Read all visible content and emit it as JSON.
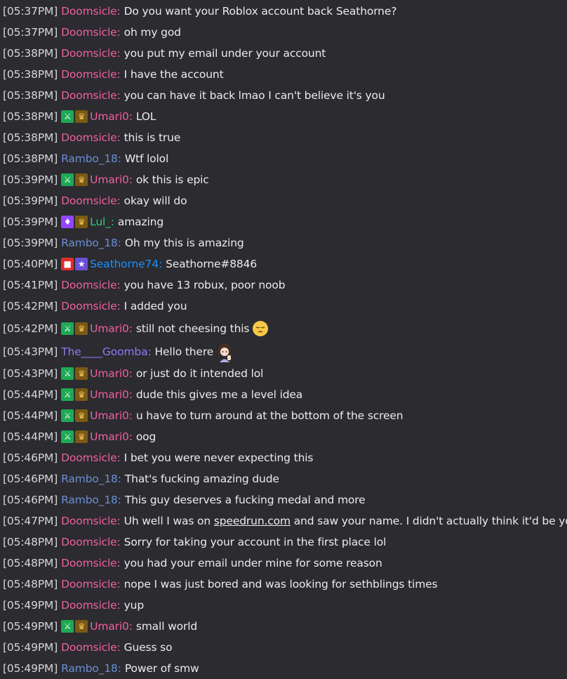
{
  "colors": {
    "background": "#2b2b30",
    "Doomsicle": "#f0609e",
    "Umari0": "#f0609e",
    "Rambo_18": "#6b8fd3",
    "Lul_": "#2ed17a",
    "Seathorne74": "#1e90ff",
    "The____Goomba": "#8a7cf5"
  },
  "messages": [
    {
      "ts": "[05:37PM]",
      "user": "Doomsicle",
      "badges": [],
      "text": "Do you want your Roblox account back Seathorne?"
    },
    {
      "ts": "[05:37PM]",
      "user": "Doomsicle",
      "badges": [],
      "text": "oh my god"
    },
    {
      "ts": "[05:38PM]",
      "user": "Doomsicle",
      "badges": [],
      "text": "you put my email under your account"
    },
    {
      "ts": "[05:38PM]",
      "user": "Doomsicle",
      "badges": [],
      "text": "I have the account"
    },
    {
      "ts": "[05:38PM]",
      "user": "Doomsicle",
      "badges": [],
      "text": "you can have it back lmao I can't believe it's you"
    },
    {
      "ts": "[05:38PM]",
      "user": "Umari0",
      "badges": [
        "moderator-sword-icon",
        "crown-icon"
      ],
      "text": "LOL"
    },
    {
      "ts": "[05:38PM]",
      "user": "Doomsicle",
      "badges": [],
      "text": "this is true"
    },
    {
      "ts": "[05:38PM]",
      "user": "Rambo_18",
      "badges": [],
      "text": "Wtf lolol"
    },
    {
      "ts": "[05:39PM]",
      "user": "Umari0",
      "badges": [
        "moderator-sword-icon",
        "crown-icon"
      ],
      "text": "ok this is epic"
    },
    {
      "ts": "[05:39PM]",
      "user": "Doomsicle",
      "badges": [],
      "text": "okay will do"
    },
    {
      "ts": "[05:39PM]",
      "user": "Lul_",
      "badges": [
        "gem-icon",
        "crown-icon"
      ],
      "text": "amazing"
    },
    {
      "ts": "[05:39PM]",
      "user": "Rambo_18",
      "badges": [],
      "text": "Oh my this is amazing"
    },
    {
      "ts": "[05:40PM]",
      "user": "Seathorne74",
      "badges": [
        "broadcaster-camera-icon",
        "star-icon"
      ],
      "text": "Seathorne#8846"
    },
    {
      "ts": "[05:41PM]",
      "user": "Doomsicle",
      "badges": [],
      "text": "you have 13 robux, poor noob"
    },
    {
      "ts": "[05:42PM]",
      "user": "Doomsicle",
      "badges": [],
      "text": "I added you"
    },
    {
      "ts": "[05:42PM]",
      "user": "Umari0",
      "badges": [
        "moderator-sword-icon",
        "crown-icon"
      ],
      "text": "still not cheesing this",
      "emote": "pensive-emoji-icon"
    },
    {
      "ts": "[05:43PM]",
      "user": "The____Goomba",
      "badges": [],
      "text": "Hello there",
      "emote": "anime-wave-emote-icon"
    },
    {
      "ts": "[05:43PM]",
      "user": "Umari0",
      "badges": [
        "moderator-sword-icon",
        "crown-icon"
      ],
      "text": "or just do it intended lol"
    },
    {
      "ts": "[05:44PM]",
      "user": "Umari0",
      "badges": [
        "moderator-sword-icon",
        "crown-icon"
      ],
      "text": "dude this gives me a level idea"
    },
    {
      "ts": "[05:44PM]",
      "user": "Umari0",
      "badges": [
        "moderator-sword-icon",
        "crown-icon"
      ],
      "text": "u have to turn around at the bottom of the screen"
    },
    {
      "ts": "[05:44PM]",
      "user": "Umari0",
      "badges": [
        "moderator-sword-icon",
        "crown-icon"
      ],
      "text": "oog"
    },
    {
      "ts": "[05:46PM]",
      "user": "Doomsicle",
      "badges": [],
      "text": "I bet you were never expecting this"
    },
    {
      "ts": "[05:46PM]",
      "user": "Rambo_18",
      "badges": [],
      "text": "That's fucking amazing dude"
    },
    {
      "ts": "[05:46PM]",
      "user": "Rambo_18",
      "badges": [],
      "text": "This guy deserves a fucking medal and more"
    },
    {
      "ts": "[05:47PM]",
      "user": "Doomsicle",
      "badges": [],
      "text": "Uh well I was on ",
      "link": "speedrun.com",
      "text_after": " and saw your name. I didn't actually think it'd be you"
    },
    {
      "ts": "[05:48PM]",
      "user": "Doomsicle",
      "badges": [],
      "text": "Sorry for taking your account in the first place lol"
    },
    {
      "ts": "[05:48PM]",
      "user": "Doomsicle",
      "badges": [],
      "text": "you had your email under mine for some reason"
    },
    {
      "ts": "[05:48PM]",
      "user": "Doomsicle",
      "badges": [],
      "text": "nope I was just bored and was looking for sethblings times"
    },
    {
      "ts": "[05:49PM]",
      "user": "Doomsicle",
      "badges": [],
      "text": "yup"
    },
    {
      "ts": "[05:49PM]",
      "user": "Umari0",
      "badges": [
        "moderator-sword-icon",
        "crown-icon"
      ],
      "text": "small world"
    },
    {
      "ts": "[05:49PM]",
      "user": "Doomsicle",
      "badges": [],
      "text": "Guess so"
    },
    {
      "ts": "[05:49PM]",
      "user": "Rambo_18",
      "badges": [],
      "text": "Power of smw"
    }
  ]
}
